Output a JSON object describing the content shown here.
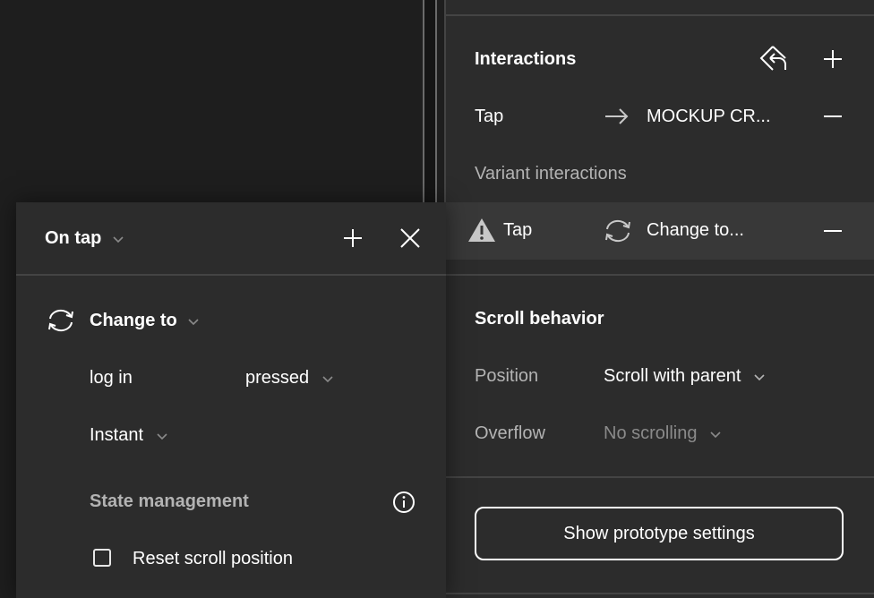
{
  "panel": {
    "interactions": {
      "title": "Interactions",
      "icons": {
        "reset": "interaction-reset-icon",
        "add": "plus-icon"
      },
      "rows": [
        {
          "trigger": "Tap",
          "action_icon": "arrow-right-icon",
          "destination": "MOCKUP CR...",
          "remove_icon": "minus-icon"
        }
      ],
      "variant_label": "Variant interactions",
      "variant_rows": [
        {
          "warning_icon": "warning-icon",
          "trigger": "Tap",
          "action_icon": "change-to-icon",
          "action": "Change to...",
          "remove_icon": "minus-icon"
        }
      ]
    },
    "scroll_behavior": {
      "title": "Scroll behavior",
      "position_label": "Position",
      "position_value": "Scroll with parent",
      "overflow_label": "Overflow",
      "overflow_value": "No scrolling"
    },
    "prototype_button": "Show prototype settings"
  },
  "popover": {
    "trigger": "On tap",
    "action": "Change to",
    "component": "log in",
    "variant": "pressed",
    "animation": "Instant",
    "state_management_label": "State management",
    "reset_scroll_label": "Reset scroll position",
    "reset_scroll_checked": false
  },
  "colors": {
    "panel_bg": "#2c2c2c",
    "canvas_bg": "#1e1e1e",
    "highlight_row": "#383838",
    "text": "#ffffff",
    "muted": "#b3b3b3"
  }
}
